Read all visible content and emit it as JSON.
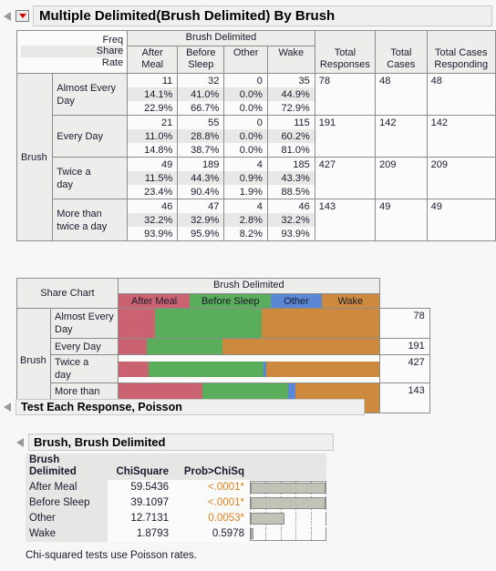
{
  "main_outline": {
    "title": "Multiple Delimited(Brush Delimited) By Brush",
    "disclosure_icon": "triangle-open-icon",
    "menu_icon": "red-triangle-menu-icon"
  },
  "crosstab": {
    "corner_labels": [
      "Freq",
      "Share",
      "Rate"
    ],
    "group_header": "Brush Delimited",
    "columns": [
      "After Meal",
      "Before Sleep",
      "Other",
      "Wake"
    ],
    "extra_columns": [
      "Total Responses",
      "Total Cases",
      "Total Cases Responding"
    ],
    "row_group_label": "Brush",
    "rows": [
      {
        "label": "Almost Every Day",
        "freq": [
          "11",
          "32",
          "0",
          "35"
        ],
        "share": [
          "14.1%",
          "41.0%",
          "0.0%",
          "44.9%"
        ],
        "rate": [
          "22.9%",
          "66.7%",
          "0.0%",
          "72.9%"
        ],
        "total_responses": "78",
        "total_cases": "48",
        "total_cases_responding": "48"
      },
      {
        "label": "Every Day",
        "freq": [
          "21",
          "55",
          "0",
          "115"
        ],
        "share": [
          "11.0%",
          "28.8%",
          "0.0%",
          "60.2%"
        ],
        "rate": [
          "14.8%",
          "38.7%",
          "0.0%",
          "81.0%"
        ],
        "total_responses": "191",
        "total_cases": "142",
        "total_cases_responding": "142"
      },
      {
        "label": "Twice a day",
        "freq": [
          "49",
          "189",
          "4",
          "185"
        ],
        "share": [
          "11.5%",
          "44.3%",
          "0.9%",
          "43.3%"
        ],
        "rate": [
          "23.4%",
          "90.4%",
          "1.9%",
          "88.5%"
        ],
        "total_responses": "427",
        "total_cases": "209",
        "total_cases_responding": "209"
      },
      {
        "label": "More than twice a day",
        "freq": [
          "46",
          "47",
          "4",
          "46"
        ],
        "share": [
          "32.2%",
          "32.9%",
          "2.8%",
          "32.2%"
        ],
        "rate": [
          "93.9%",
          "95.9%",
          "8.2%",
          "93.9%"
        ],
        "total_responses": "143",
        "total_cases": "49",
        "total_cases_responding": "49"
      }
    ]
  },
  "share_chart": {
    "corner_label": "Share Chart",
    "group_header": "Brush Delimited",
    "row_group_label": "Brush",
    "legend": [
      {
        "label": "After Meal",
        "color": "#cb6272",
        "width_pct": 27.5
      },
      {
        "label": "Before Sleep",
        "color": "#5aad5a",
        "width_pct": 31.0
      },
      {
        "label": "Other",
        "color": "#5b86d4",
        "width_pct": 19.5
      },
      {
        "label": "Wake",
        "color": "#cd8a3f",
        "width_pct": 22.0
      }
    ],
    "rows": [
      {
        "label": "Almost Every Day",
        "segments": [
          14.1,
          41.0,
          0.0,
          44.9
        ],
        "total": "78"
      },
      {
        "label": "Every Day",
        "segments": [
          11.0,
          28.8,
          0.0,
          60.2
        ],
        "total": "191"
      },
      {
        "label": "Twice a day",
        "segments": [
          11.5,
          44.3,
          0.9,
          43.3
        ],
        "total": "427"
      },
      {
        "label": "More than twice a day",
        "segments": [
          32.2,
          32.9,
          2.8,
          32.2
        ],
        "total": "143"
      }
    ]
  },
  "test_outline": {
    "title": "Test Each Response, Poisson",
    "disclosure_icon": "triangle-open-icon"
  },
  "brush_outline": {
    "title": "Brush, Brush Delimited",
    "disclosure_icon": "triangle-open-icon"
  },
  "poisson_table": {
    "headers": [
      "Brush Delimited",
      "ChiSquare",
      "Prob>ChiSq"
    ],
    "header_line1": "Brush",
    "header_line2": "Delimited",
    "rows": [
      {
        "label": "After Meal",
        "chisquare": "59.5436",
        "prob": "<.0001*",
        "significant": true,
        "bar_pct": 100
      },
      {
        "label": "Before Sleep",
        "chisquare": "39.1097",
        "prob": "<.0001*",
        "significant": true,
        "bar_pct": 100
      },
      {
        "label": "Other",
        "chisquare": "12.7131",
        "prob": "0.0053*",
        "significant": true,
        "bar_pct": 45
      },
      {
        "label": "Wake",
        "chisquare": "1.8793",
        "prob": "0.5978",
        "significant": false,
        "bar_pct": 4
      }
    ],
    "gridlines_pct": [
      20,
      40,
      60,
      80
    ]
  },
  "footnote": "Chi-squared tests use Poisson rates.",
  "colors": {
    "after_meal": "#cb6272",
    "before_sleep": "#5aad5a",
    "other": "#5b86d4",
    "wake": "#cd8a3f",
    "significant_text": "#e08019",
    "bar_fill": "#c3c2b6",
    "header_bg": "#ededeb",
    "page_bg": "#f7f7f7"
  }
}
